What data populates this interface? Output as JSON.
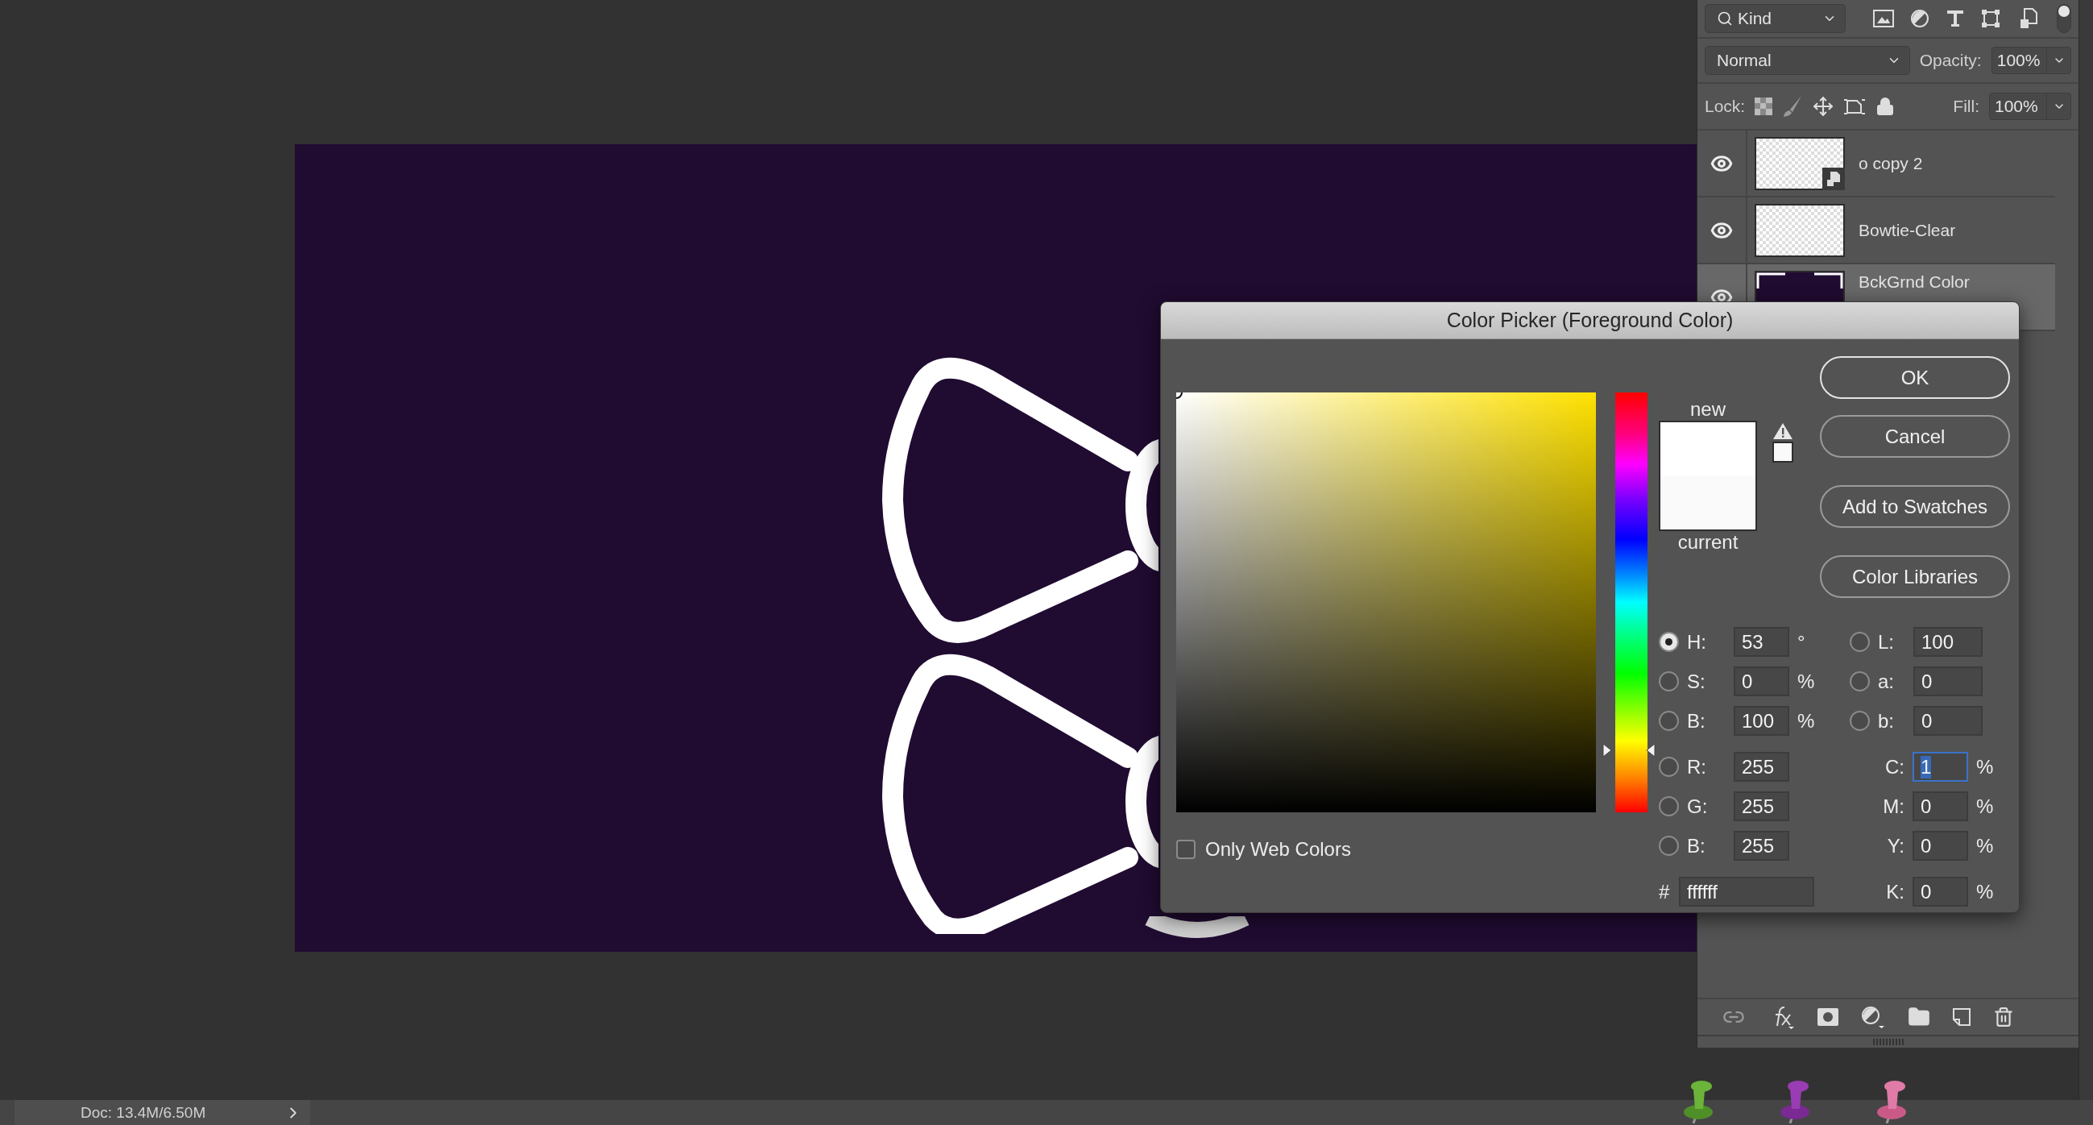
{
  "layers_panel": {
    "filter": {
      "label": "Kind"
    },
    "blend_mode": "Normal",
    "opacity": {
      "label": "Opacity:",
      "value": "100%"
    },
    "lock_label": "Lock:",
    "fill": {
      "label": "Fill:",
      "value": "100%"
    },
    "layers": [
      {
        "name": "o copy 2",
        "visible": true,
        "selected": false,
        "kind": "smart"
      },
      {
        "name": "Bowtie-Clear",
        "visible": true,
        "selected": false,
        "kind": "pixel"
      },
      {
        "name": "BckGrnd Color",
        "visible": true,
        "selected": true,
        "kind": "fill"
      }
    ]
  },
  "dialog": {
    "title": "Color Picker (Foreground Color)",
    "new_label": "new",
    "current_label": "current",
    "hue_slider": {
      "level": 0.147
    },
    "only_web_colors": {
      "label": "Only Web Colors",
      "checked": false
    },
    "buttons": [
      {
        "label": "OK",
        "default": true
      },
      {
        "label": "Cancel",
        "default": false
      },
      {
        "label": "Add to Swatches",
        "default": false
      },
      {
        "label": "Color Libraries",
        "default": false
      }
    ],
    "hsb_fields": [
      {
        "label": "H:",
        "value": "53",
        "unit": "°",
        "selected": true
      },
      {
        "label": "S:",
        "value": "0",
        "unit": "%",
        "selected": false
      },
      {
        "label": "B:",
        "value": "100",
        "unit": "%",
        "selected": false
      }
    ],
    "rgb_fields": [
      {
        "label": "R:",
        "value": "255",
        "selected": false
      },
      {
        "label": "G:",
        "value": "255",
        "selected": false
      },
      {
        "label": "B:",
        "value": "255",
        "selected": false
      }
    ],
    "lab_fields": [
      {
        "label": "L:",
        "value": "100",
        "selected": false
      },
      {
        "label": "a:",
        "value": "0",
        "selected": false
      },
      {
        "label": "b:",
        "value": "0",
        "selected": false
      }
    ],
    "cmyk_fields": [
      {
        "label": "C:",
        "value": "1",
        "unit": "%",
        "focused": true
      },
      {
        "label": "M:",
        "value": "0",
        "unit": "%",
        "focused": false
      },
      {
        "label": "Y:",
        "value": "0",
        "unit": "%",
        "focused": false
      },
      {
        "label": "K:",
        "value": "0",
        "unit": "%",
        "focused": false
      }
    ],
    "hex": {
      "label": "#",
      "value": "ffffff"
    }
  },
  "status_bar": {
    "doc": "Doc: 13.4M/6.50M"
  }
}
